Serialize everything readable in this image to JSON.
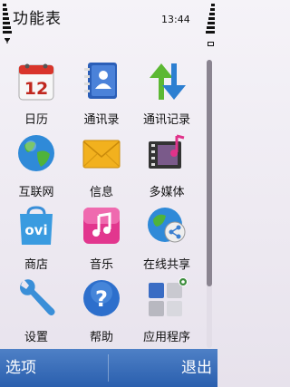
{
  "header": {
    "title": "功能表",
    "clock": "13:44"
  },
  "grid": {
    "items": [
      {
        "label": "日历",
        "icon": "calendar-icon",
        "badge": "12"
      },
      {
        "label": "通讯录",
        "icon": "contacts-icon"
      },
      {
        "label": "通讯记录",
        "icon": "call-log-icon"
      },
      {
        "label": "互联网",
        "icon": "globe-icon"
      },
      {
        "label": "信息",
        "icon": "envelope-icon"
      },
      {
        "label": "多媒体",
        "icon": "multimedia-icon"
      },
      {
        "label": "商店",
        "icon": "ovi-store-icon",
        "badge": "ovi"
      },
      {
        "label": "音乐",
        "icon": "music-icon"
      },
      {
        "label": "在线共享",
        "icon": "share-online-icon"
      },
      {
        "label": "设置",
        "icon": "wrench-icon"
      },
      {
        "label": "帮助",
        "icon": "help-icon",
        "badge": "?"
      },
      {
        "label": "应用程序",
        "icon": "applications-icon"
      }
    ]
  },
  "softkeys": {
    "left": "选项",
    "right": "退出"
  },
  "colors": {
    "softbar": "#3a6cb8",
    "accent": "#2a5fae"
  }
}
